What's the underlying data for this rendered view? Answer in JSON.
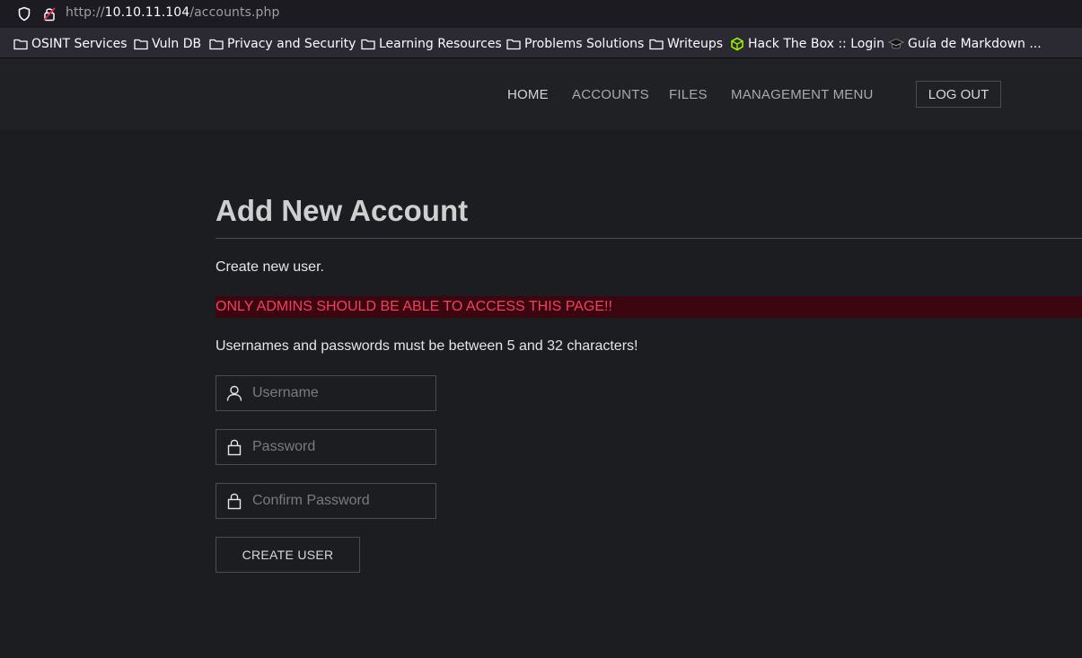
{
  "browser": {
    "url_prefix": "http://",
    "url_host": "10.10.11.104",
    "url_path": "/accounts.php",
    "bookmarks": [
      {
        "label": "OSINT Services",
        "icon": "folder-icon"
      },
      {
        "label": "Vuln DB",
        "icon": "folder-icon"
      },
      {
        "label": "Privacy and Security",
        "icon": "folder-icon"
      },
      {
        "label": "Learning Resources",
        "icon": "folder-icon"
      },
      {
        "label": "Problems Solutions",
        "icon": "folder-icon"
      },
      {
        "label": "Writeups",
        "icon": "folder-icon"
      },
      {
        "label": "Hack The Box :: Login",
        "icon": "htb-cube-icon"
      },
      {
        "label": "Guía de Markdown ...",
        "icon": "graduation-cap-icon"
      }
    ]
  },
  "nav": {
    "home": "HOME",
    "accounts": "ACCOUNTS",
    "files": "FILES",
    "management": "MANAGEMENT MENU",
    "logout": "LOG OUT"
  },
  "page": {
    "title": "Add New Account",
    "subtitle": "Create new user.",
    "warning": "ONLY ADMINS SHOULD BE ABLE TO ACCESS THIS PAGE!!",
    "rules": "Usernames and passwords must be between 5 and 32 characters!"
  },
  "form": {
    "username_placeholder": "Username",
    "password_placeholder": "Password",
    "confirm_placeholder": "Confirm Password",
    "submit_label": "CREATE USER"
  },
  "colors": {
    "background": "#1c1d20",
    "header": "#202124",
    "warning_bg": "#3c0611",
    "warning_text": "#f0415f",
    "htb_green": "#9fef00"
  }
}
